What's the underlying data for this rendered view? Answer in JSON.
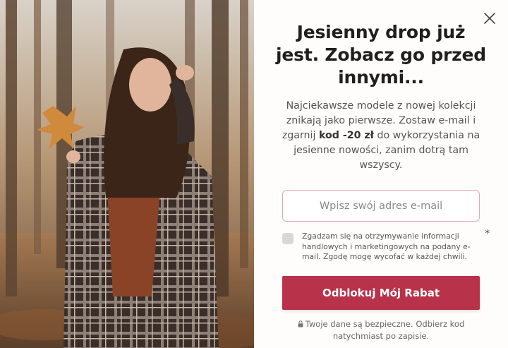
{
  "popup": {
    "headline": "Jesienny drop już jest. Zobacz go przed innymi...",
    "description_part1": "Najciekawsze modele z nowej kolekcji znikają jako pierwsze. Zostaw e-mail i zgarnij ",
    "description_bold": "kod -20 zł",
    "description_part2": " do wykorzystania na jesienne nowości, zanim dotrą tam wszyscy.",
    "email_placeholder": "Wpisz swój adres e-mail",
    "email_value": "",
    "consent_text": "Zgadzam się na otrzymywanie informacji handlowych i marketingowych na podany e-mail. Zgodę mogę wycofać w każdej chwili.",
    "consent_required_mark": "*",
    "consent_checked": false,
    "cta_label": "Odblokuj Mój Rabat",
    "security_note": "Twoje dane są bezpieczne. Odbierz kod natychmiast po zapisie."
  },
  "image": {
    "subject": "woman-in-plaid-coat-holding-autumn-leaf"
  },
  "colors": {
    "accent": "#b8324a",
    "input_border": "#e4a9b5",
    "checkbox": "#d8d8d8",
    "background": "#fffdfb"
  },
  "icons": {
    "close": "close-icon",
    "lock": "lock-icon"
  }
}
